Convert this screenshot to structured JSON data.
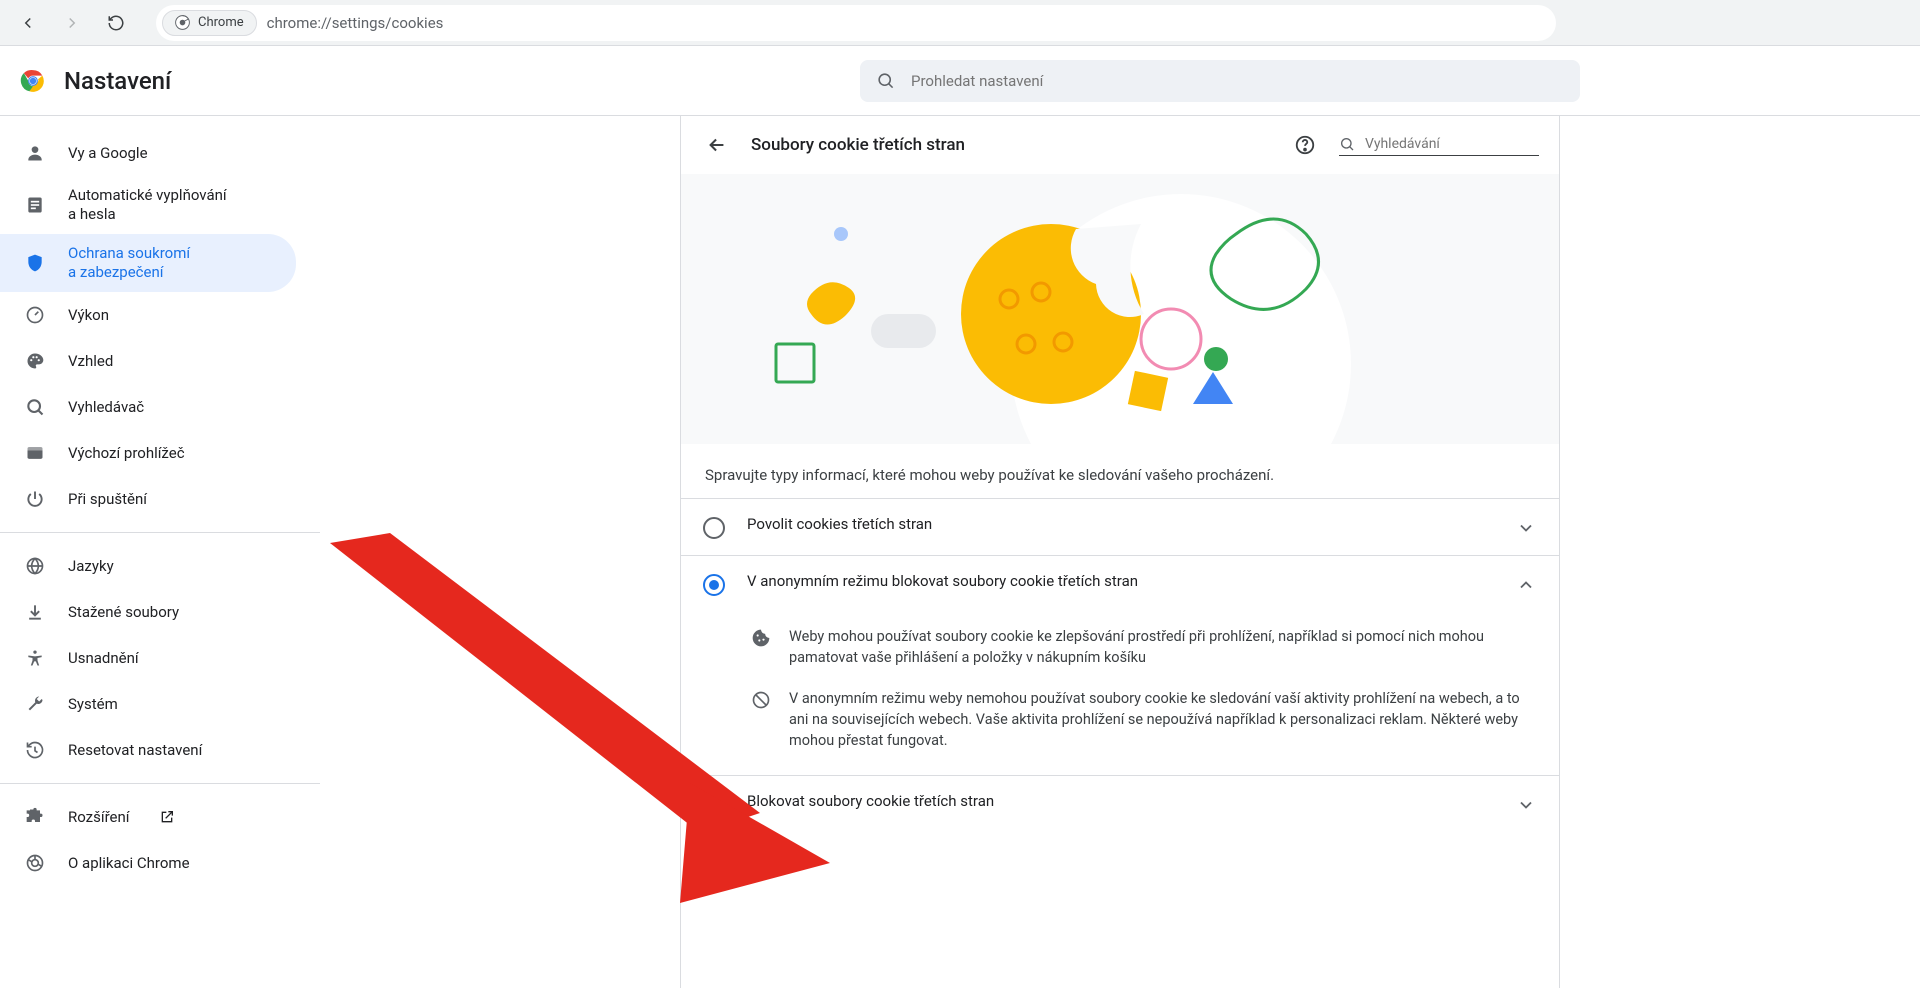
{
  "toolbar": {
    "chip_label": "Chrome",
    "url": "chrome://settings/cookies"
  },
  "header": {
    "title": "Nastavení",
    "search_placeholder": "Prohledat nastavení"
  },
  "sidebar": {
    "items": [
      {
        "label": "Vy a Google"
      },
      {
        "label": "Automatické vyplňování\na hesla"
      },
      {
        "label": "Ochrana soukromí\na zabezpečení"
      },
      {
        "label": "Výkon"
      },
      {
        "label": "Vzhled"
      },
      {
        "label": "Vyhledávač"
      },
      {
        "label": "Výchozí prohlížeč"
      },
      {
        "label": "Při spuštění"
      }
    ],
    "items2": [
      {
        "label": "Jazyky"
      },
      {
        "label": "Stažené soubory"
      },
      {
        "label": "Usnadnění"
      },
      {
        "label": "Systém"
      },
      {
        "label": "Resetovat nastavení"
      }
    ],
    "items3": [
      {
        "label": "Rozšíření"
      },
      {
        "label": "O aplikaci Chrome"
      }
    ]
  },
  "main": {
    "title": "Soubory cookie třetích stran",
    "search_placeholder": "Vyhledávání",
    "intro": "Spravujte typy informací, které mohou weby používat ke sledování vašeho procházení.",
    "options": {
      "allow": "Povolit cookies třetích stran",
      "incognito": "V anonymním režimu blokovat soubory cookie třetích stran",
      "block": "Blokovat soubory cookie třetích stran"
    },
    "details": {
      "cookie": "Weby mohou používat soubory cookie ke zlepšování prostředí při prohlížení, například si pomocí nich mohou pamatovat vaše přihlášení a položky v nákupním košíku",
      "block": "V anonymním režimu weby nemohou používat soubory cookie ke sledování vaší aktivity prohlížení na webech, a to ani na souvisejících webech. Vaše aktivita prohlížení se nepoužívá například k personalizaci reklam. Některé weby mohou přestat fungovat."
    }
  }
}
